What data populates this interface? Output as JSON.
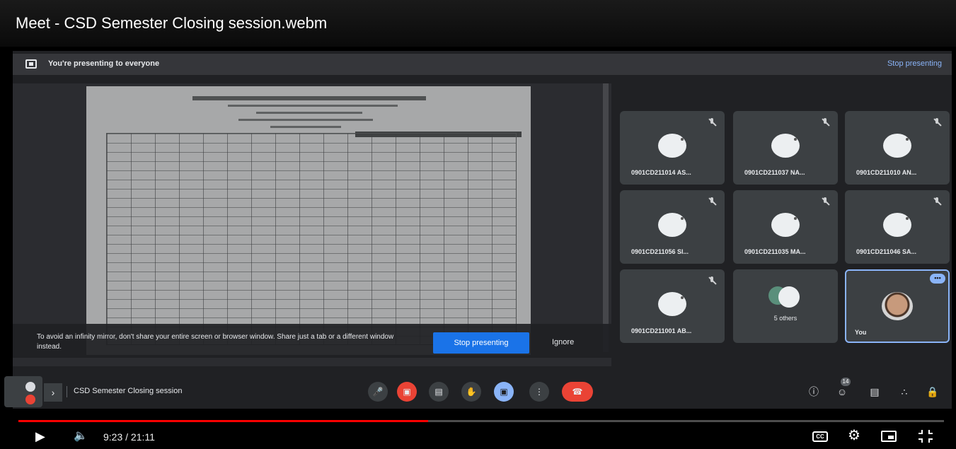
{
  "player": {
    "title": "Meet - CSD Semester Closing session.webm",
    "current_time": "9:23",
    "duration": "21:11",
    "time_display": "9:23 / 21:11",
    "progress_fraction": 0.443,
    "accent_color": "#ff0000"
  },
  "meet": {
    "present_banner": {
      "text": "You're presenting to everyone",
      "stop_link": "Stop presenting"
    },
    "infinity_warning": {
      "text": "To avoid an infinity mirror, don't share your entire screen or browser window. Share just a tab or a different window instead.",
      "stop_button": "Stop presenting",
      "ignore_button": "Ignore"
    },
    "participants": [
      {
        "name": "0901CD211014 AS..."
      },
      {
        "name": "0901CD211037 NA..."
      },
      {
        "name": "0901CD211010 AN..."
      },
      {
        "name": "0901CD211056 SI..."
      },
      {
        "name": "0901CD211035 MA..."
      },
      {
        "name": "0901CD211046 SA..."
      },
      {
        "name": "0901CD211001 AB..."
      }
    ],
    "others_label": "5 others",
    "you_label": "You",
    "meeting_name": "CSD Semester Closing session",
    "participant_count": "14",
    "colors": {
      "background": "#202124",
      "tile": "#3c4043",
      "accent_blue": "#8ab4f8",
      "end_call_red": "#ea4335",
      "primary_button": "#1a73e8"
    }
  },
  "icons": {
    "play": "play-icon",
    "volume": "volume-icon",
    "captions": "captions-icon",
    "settings": "gear-icon",
    "miniplayer": "miniplayer-icon",
    "exit_fullscreen": "exit-fullscreen-icon"
  }
}
